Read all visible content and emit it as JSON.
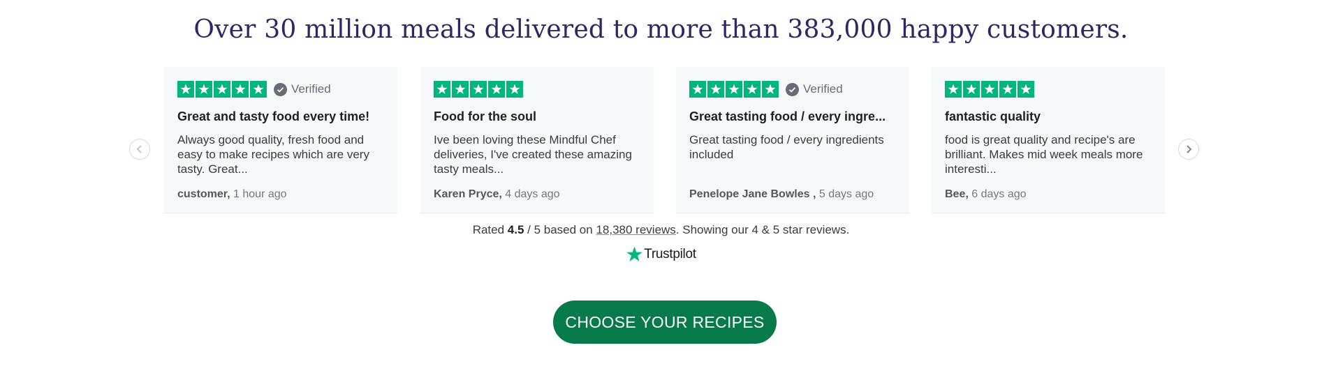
{
  "headline": "Over 30 million meals delivered to more than 383,000 happy customers.",
  "colors": {
    "headline": "#2f2668",
    "star_green": "#00b67a",
    "cta_green": "#067a4a",
    "card_bg": "#f7f8fa"
  },
  "reviews": [
    {
      "stars": 5,
      "verified": true,
      "verified_label": "Verified",
      "title": "Great and tasty food every time!",
      "body": "Always good quality, fresh food and easy to make recipes which are very tasty. Great...",
      "author": "customer,",
      "time": " 1 hour ago"
    },
    {
      "stars": 5,
      "verified": false,
      "verified_label": "",
      "title": "Food for the soul",
      "body": "Ive been loving these Mindful Chef deliveries, I've created these amazing tasty meals...",
      "author": "Karen Pryce,",
      "time": " 4 days ago"
    },
    {
      "stars": 5,
      "verified": true,
      "verified_label": "Verified",
      "title": "Great tasting food / every ingre...",
      "body": "Great tasting food / every ingredients included",
      "author": "Penelope Jane Bowles ,",
      "time": " 5 days ago"
    },
    {
      "stars": 5,
      "verified": false,
      "verified_label": "",
      "title": "fantastic quality",
      "body": "food is great quality and recipe's are brilliant. Makes mid week meals more interesti...",
      "author": "Bee,",
      "time": " 6 days ago"
    }
  ],
  "carousel": {
    "prev_icon": "chevron-left-icon",
    "next_icon": "chevron-right-icon"
  },
  "rating": {
    "prefix": "Rated ",
    "score": "4.5",
    "out_of": " / 5 based on ",
    "reviews_link": "18,380 reviews",
    "suffix": ". Showing our 4 & 5 star reviews."
  },
  "trustpilot_logo": "Trustpilot",
  "cta_label": "CHOOSE YOUR RECIPES"
}
